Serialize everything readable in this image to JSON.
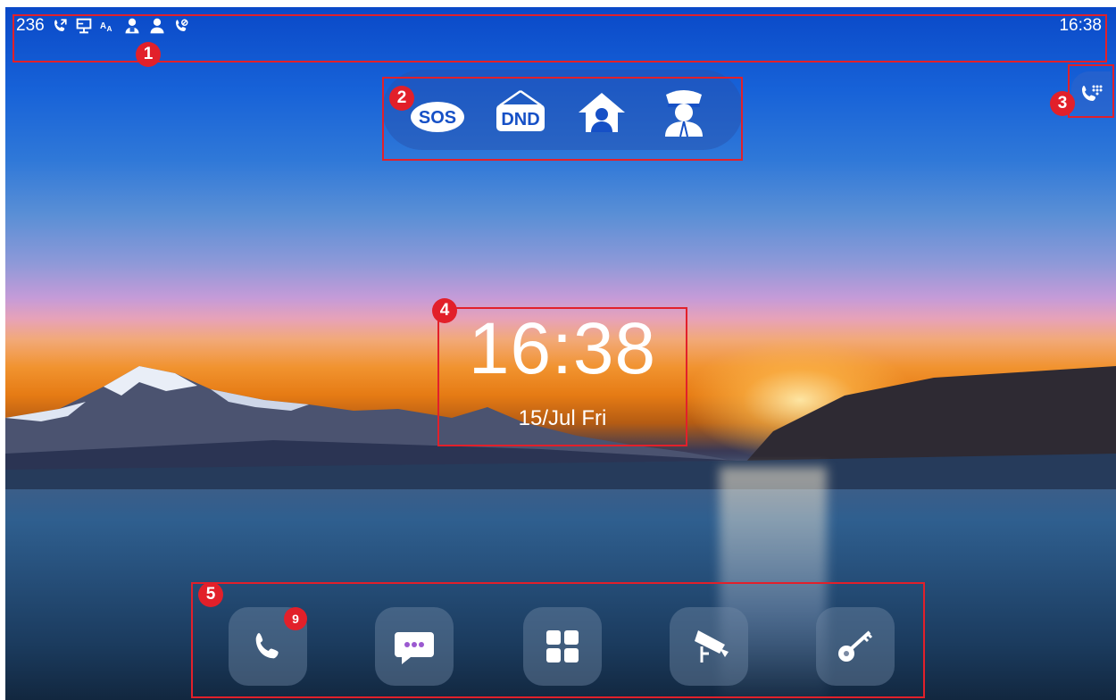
{
  "status_bar": {
    "extension": "236",
    "time": "16:38",
    "icons": [
      "call-forward-icon",
      "network-icon",
      "language-icon",
      "user-locked-icon",
      "user-icon",
      "call-blocked-icon"
    ]
  },
  "quick_actions": [
    {
      "id": "sos",
      "label": "SOS",
      "icon": "sos-icon"
    },
    {
      "id": "dnd",
      "label": "DND",
      "icon": "dnd-icon"
    },
    {
      "id": "home",
      "icon": "home-person-icon"
    },
    {
      "id": "guard",
      "icon": "guard-icon"
    }
  ],
  "side_button": {
    "icon": "dialpad-phone-icon"
  },
  "clock": {
    "time": "16:38",
    "date": "15/Jul Fri"
  },
  "dock": [
    {
      "id": "phone",
      "icon": "phone-icon",
      "badge": "9"
    },
    {
      "id": "messages",
      "icon": "message-icon"
    },
    {
      "id": "apps",
      "icon": "apps-grid-icon"
    },
    {
      "id": "monitor",
      "icon": "camera-icon"
    },
    {
      "id": "unlock",
      "icon": "key-icon"
    }
  ],
  "annotations": [
    "1",
    "2",
    "3",
    "4",
    "5"
  ],
  "colors": {
    "annotation": "#e2202a",
    "message_dots": "#9b59d0"
  }
}
